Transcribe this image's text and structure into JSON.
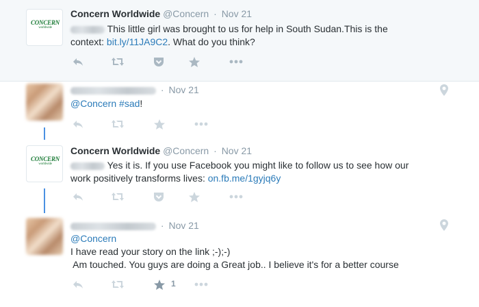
{
  "tweets": [
    {
      "author_name": "Concern Worldwide",
      "author_handle": "@Concern",
      "time": "Nov 21",
      "logo_text": "CONCERN",
      "logo_sub": "worldwide",
      "text_pre": "This little girl was brought to us for help in South Sudan.This is the",
      "text_line2_pre": "context: ",
      "link": "bit.ly/11JA9C2",
      "text_line2_post": ". What do you think?"
    },
    {
      "time": "Nov 21",
      "mention": "@Concern",
      "hashtag": "#sad",
      "suffix": "!"
    },
    {
      "author_name": "Concern Worldwide",
      "author_handle": "@Concern",
      "time": "Nov 21",
      "logo_text": "CONCERN",
      "logo_sub": "worldwide",
      "text_pre": "Yes it is. If you use Facebook you might like to follow us to see how our",
      "text_line2_pre": "work positively transforms lives: ",
      "link": "on.fb.me/1gyjq6y"
    },
    {
      "time": "Nov 21",
      "mention": "@Concern",
      "line2": "I have read your story on the link ;-);-)",
      "line3": " Am touched. You guys are doing a Great job.. I believe it's for a better course",
      "favorite_count": "1"
    }
  ],
  "separator": "·",
  "accent_color": "#2b7bb9",
  "thread_line_color": "#4a90e2",
  "icons": [
    "reply-icon",
    "retweet-icon",
    "pocket-icon",
    "favorite-icon",
    "more-icon",
    "location-icon"
  ]
}
